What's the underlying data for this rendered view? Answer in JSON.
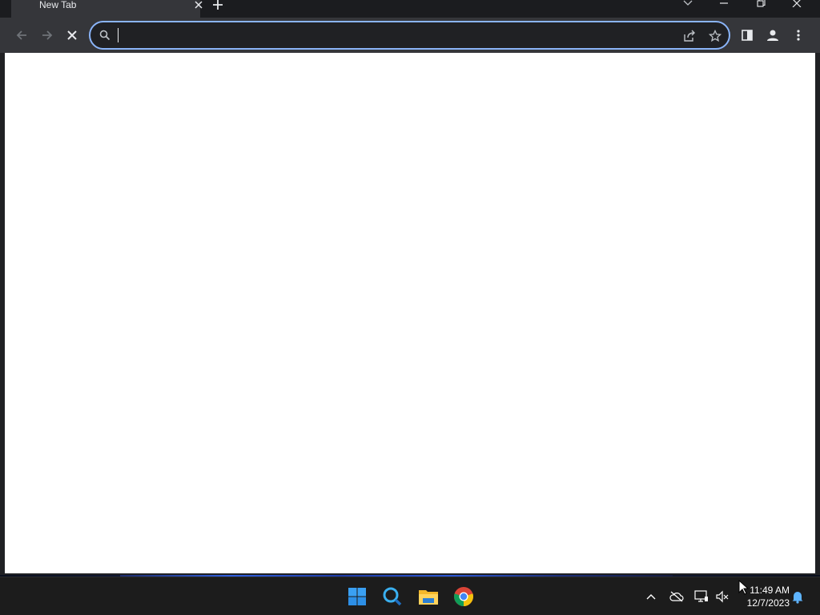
{
  "browser": {
    "tab": {
      "title": "New Tab",
      "close_icon": "close-icon"
    },
    "new_tab_icon": "plus-icon",
    "window_controls": [
      "tab-search-icon",
      "minimize-icon",
      "restore-icon",
      "close-window-icon"
    ],
    "toolbar": {
      "back_icon": "back-arrow-icon",
      "forward_icon": "forward-arrow-icon",
      "stop_icon": "stop-loading-icon",
      "omnibox": {
        "value": "",
        "placeholder": "",
        "search_icon": "search-icon",
        "share_icon": "share-icon",
        "bookmark_icon": "star-icon"
      },
      "side_panel_icon": "side-panel-icon",
      "profile_icon": "profile-icon",
      "menu_icon": "kebab-menu-icon"
    },
    "accent": "#8ab4f8"
  },
  "taskbar": {
    "apps": [
      "windows-start-icon",
      "search-app-icon",
      "file-explorer-icon",
      "chrome-icon"
    ],
    "tray": {
      "show_hidden_icon": "chevron-up-icon",
      "onedrive_icon": "cloud-offline-icon",
      "network_icon": "network-icon",
      "volume_icon": "volume-muted-icon",
      "notifications_icon": "bell-icon"
    },
    "clock": {
      "time": "11:49 AM",
      "date": "12/7/2023"
    }
  }
}
